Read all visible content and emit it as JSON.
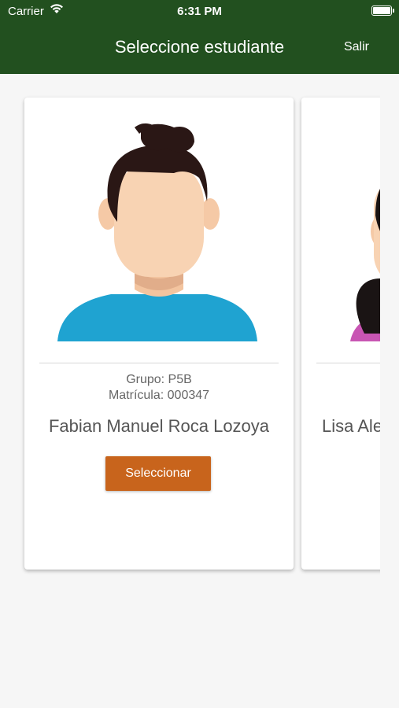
{
  "status_bar": {
    "carrier": "Carrier",
    "time": "6:31 PM"
  },
  "header": {
    "title": "Seleccione estudiante",
    "logout_label": "Salir"
  },
  "students": [
    {
      "group": "Grupo: P5B",
      "id": "Matrícula: 000347",
      "name": "Fabian Manuel Roca Lozoya",
      "button_label": "Seleccionar"
    },
    {
      "name": "Lisa Ale"
    }
  ],
  "colors": {
    "header_bg": "#22501f",
    "button_bg": "#c8641c",
    "shirt_blue": "#1fa3d1",
    "shirt_pink": "#c855b3"
  }
}
